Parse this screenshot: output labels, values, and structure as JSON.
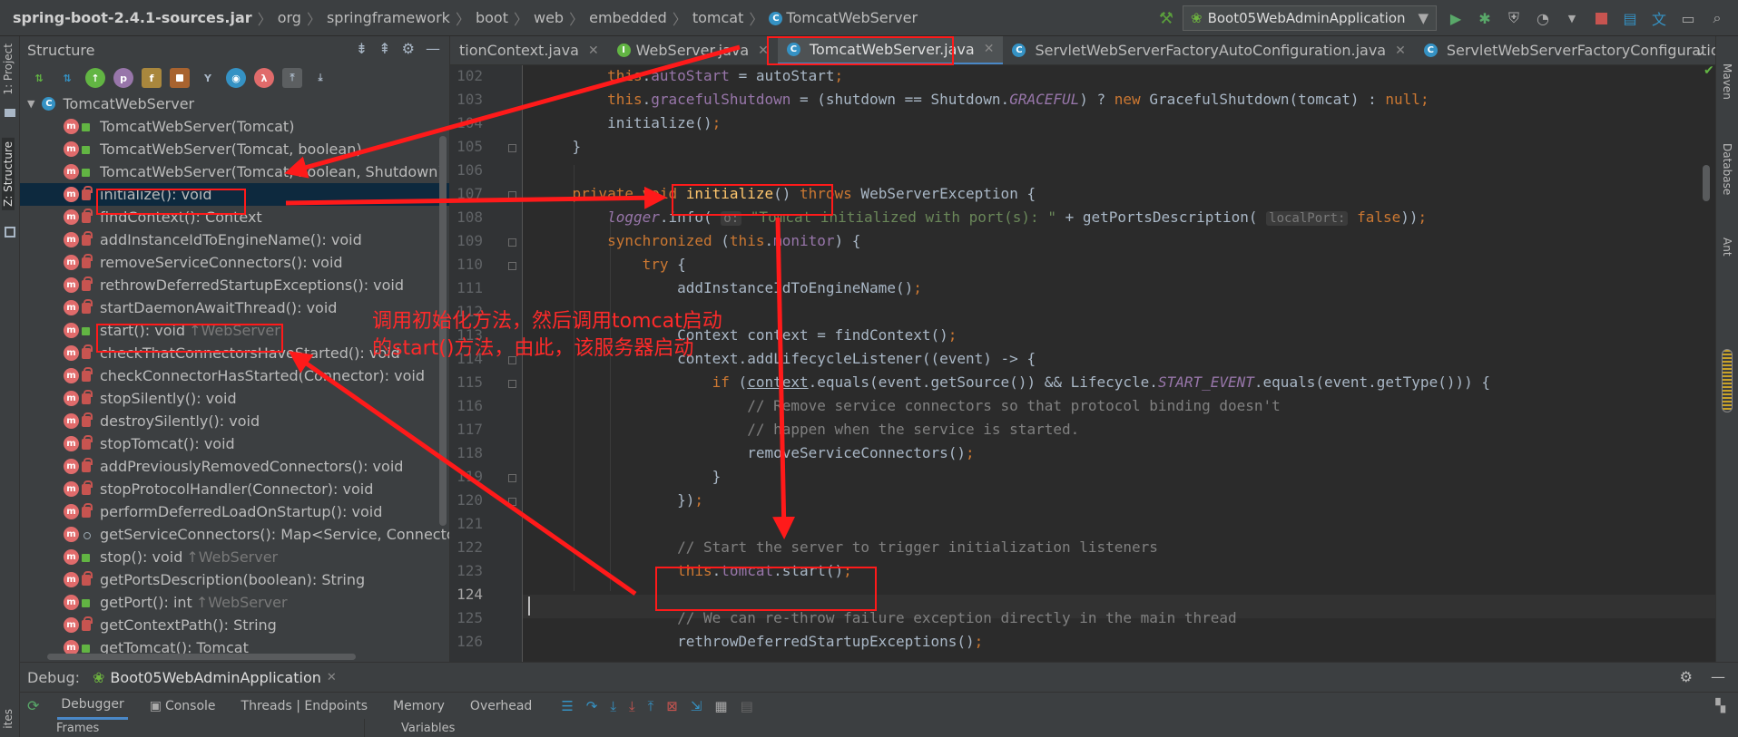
{
  "breadcrumbs": [
    "spring-boot-2.4.1-sources.jar",
    "org",
    "springframework",
    "boot",
    "web",
    "embedded",
    "tomcat",
    "TomcatWebServer"
  ],
  "run_config": {
    "name": "Boot05WebAdminApplication",
    "icon": "spring-boot-icon"
  },
  "left_tabs": {
    "project": "1: Project",
    "structure": "Z: Structure",
    "favorites": "ites"
  },
  "right_tabs": {
    "maven": "Maven",
    "database": "Database",
    "ant": "Ant"
  },
  "structure": {
    "title": "Structure",
    "root": "TomcatWebServer",
    "items": [
      {
        "label": "TomcatWebServer(Tomcat)",
        "vis": "pub",
        "inherited": ""
      },
      {
        "label": "TomcatWebServer(Tomcat, boolean)",
        "vis": "pub",
        "inherited": ""
      },
      {
        "label": "TomcatWebServer(Tomcat, boolean, Shutdown)",
        "vis": "pub",
        "inherited": ""
      },
      {
        "label": "initialize(): void",
        "vis": "priv",
        "inherited": ""
      },
      {
        "label": "findContext(): Context",
        "vis": "priv",
        "inherited": ""
      },
      {
        "label": "addInstanceIdToEngineName(): void",
        "vis": "priv",
        "inherited": ""
      },
      {
        "label": "removeServiceConnectors(): void",
        "vis": "priv",
        "inherited": ""
      },
      {
        "label": "rethrowDeferredStartupExceptions(): void",
        "vis": "priv",
        "inherited": ""
      },
      {
        "label": "startDaemonAwaitThread(): void",
        "vis": "priv",
        "inherited": ""
      },
      {
        "label": "start(): void",
        "vis": "pub",
        "inherited": "↑WebServer"
      },
      {
        "label": "checkThatConnectorsHaveStarted(): void",
        "vis": "priv",
        "inherited": ""
      },
      {
        "label": "checkConnectorHasStarted(Connector): void",
        "vis": "priv",
        "inherited": ""
      },
      {
        "label": "stopSilently(): void",
        "vis": "priv",
        "inherited": ""
      },
      {
        "label": "destroySilently(): void",
        "vis": "priv",
        "inherited": ""
      },
      {
        "label": "stopTomcat(): void",
        "vis": "priv",
        "inherited": ""
      },
      {
        "label": "addPreviouslyRemovedConnectors(): void",
        "vis": "priv",
        "inherited": ""
      },
      {
        "label": "stopProtocolHandler(Connector): void",
        "vis": "priv",
        "inherited": ""
      },
      {
        "label": "performDeferredLoadOnStartup(): void",
        "vis": "priv",
        "inherited": ""
      },
      {
        "label": "getServiceConnectors(): Map<Service, Connector[]>",
        "vis": "pkg",
        "inherited": ""
      },
      {
        "label": "stop(): void",
        "vis": "pub",
        "inherited": "↑WebServer"
      },
      {
        "label": "getPortsDescription(boolean): String",
        "vis": "priv",
        "inherited": ""
      },
      {
        "label": "getPort(): int",
        "vis": "pub",
        "inherited": "↑WebServer"
      },
      {
        "label": "getContextPath(): String",
        "vis": "priv",
        "inherited": ""
      },
      {
        "label": "getTomcat(): Tomcat",
        "vis": "pub",
        "inherited": ""
      }
    ]
  },
  "tabs": [
    {
      "label": "tionContext.java",
      "icon": "",
      "active": false
    },
    {
      "label": "WebServer.java",
      "icon": "interface-icon",
      "active": false
    },
    {
      "label": "TomcatWebServer.java",
      "icon": "class-icon",
      "active": true
    },
    {
      "label": "ServletWebServerFactoryAutoConfiguration.java",
      "icon": "class-icon",
      "active": false
    },
    {
      "label": "ServletWebServerFactoryConfiguration.java",
      "icon": "class-icon",
      "active": false
    }
  ],
  "editor": {
    "current_line": 124,
    "line_numbers": [
      "102",
      "103",
      "104",
      "105",
      "106",
      "107",
      "108",
      "109",
      "110",
      "111",
      "112",
      "113",
      "114",
      "115",
      "116",
      "117",
      "118",
      "119",
      "120",
      "121",
      "122",
      "123",
      "124",
      "125",
      "126"
    ]
  },
  "debug": {
    "title": "Debug:",
    "session": "Boot05WebAdminApplication",
    "tabs": [
      "Debugger",
      "Console",
      "Threads | Endpoints",
      "Memory",
      "Overhead"
    ],
    "columns": [
      "Frames",
      "Variables"
    ]
  },
  "annotation": {
    "line1": "调用初始化方法，然后调用tomcat启动",
    "line2": "的start()方法，由此，该服务器启动"
  }
}
